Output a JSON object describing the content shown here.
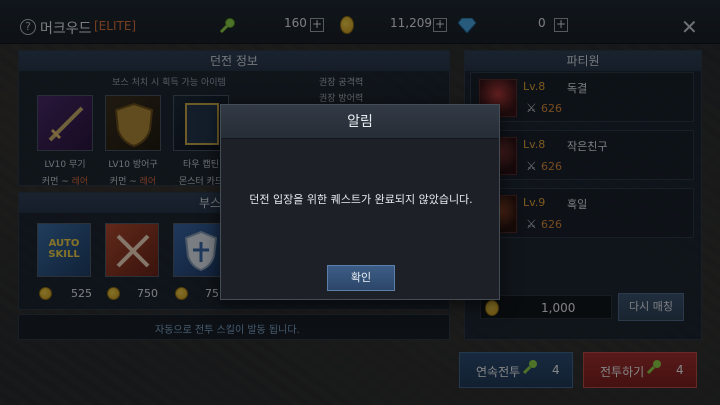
{
  "topbar": {
    "dungeon_name": "머크우드",
    "grade": "[ELITE]",
    "keys": "160",
    "gold": "11,209",
    "gems": "0"
  },
  "dungeon_info": {
    "title": "던전 정보",
    "subtitle": "보스 처치 시 획득 가능 아이템",
    "items": [
      {
        "line1": "LV10 무기",
        "grade_prefix": "커먼 ~ ",
        "grade_rare": "레어"
      },
      {
        "line1": "LV10 방어구",
        "grade_prefix": "커먼 ~ ",
        "grade_rare": "레어"
      },
      {
        "line1": "타우 캡틴",
        "grade_prefix": "몬스터 카드",
        "grade_rare": ""
      }
    ],
    "stats": [
      {
        "label": "권장 공격력"
      },
      {
        "label": "권장 방어력"
      }
    ]
  },
  "booster": {
    "title": "부스",
    "items": [
      {
        "name": "AUTO SKILL",
        "cost": "525"
      },
      {
        "name": "attack-boost",
        "cost": "750"
      },
      {
        "name": "defense-boost",
        "cost": "75"
      }
    ],
    "message": "자동으로 전투 스킬이 발동 됩니다."
  },
  "party": {
    "title": "파티원",
    "members": [
      {
        "level": "Lv.8",
        "name": "독결",
        "power": "626"
      },
      {
        "level": "Lv.8",
        "name": "작은친구",
        "power": "626"
      },
      {
        "level": "Lv.9",
        "name": "혹일",
        "power": "626"
      }
    ],
    "gold_cost": "1,000",
    "rematch_label": "다시 매칭"
  },
  "actions": {
    "continuous_label": "연속전투",
    "continuous_count": "4",
    "battle_label": "전투하기",
    "battle_count": "4"
  },
  "modal": {
    "title": "알림",
    "message": "던전 입장을 위한 퀘스트가 완료되지 않았습니다.",
    "ok_label": "확인"
  },
  "colors": {
    "accent_orange": "#d9743a",
    "gold_coin": "#e3b72e",
    "battle_red": "#a23030",
    "continuous_blue": "#2d4d73"
  }
}
